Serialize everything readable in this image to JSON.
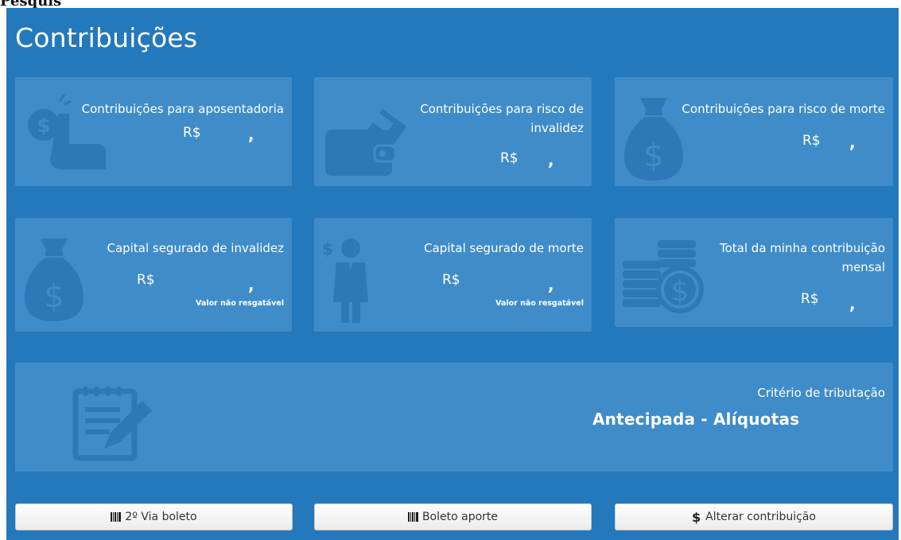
{
  "top_label": "Pesquis",
  "title": "Contribuições",
  "cards": [
    {
      "label": "Contribuições para aposentadoria",
      "currency": "R$",
      "comma": ","
    },
    {
      "label_line1": "Contribuições para risco de",
      "label_line2": "invalidez",
      "currency": "R$",
      "comma": ","
    },
    {
      "label": "Contribuições para risco de morte",
      "currency": "R$",
      "comma": ","
    },
    {
      "label": "Capital segurado de invalidez",
      "currency": "R$",
      "comma": ",",
      "note": "Valor não resgatável"
    },
    {
      "label": "Capital segurado de morte",
      "currency": "R$",
      "comma": ",",
      "note": "Valor não resgatável"
    },
    {
      "label_line1": "Total da minha contribuição",
      "label_line2": "mensal",
      "currency": "R$",
      "comma": ","
    }
  ],
  "tax": {
    "label": "Critério de tributação",
    "value": "Antecipada - Alíquotas"
  },
  "buttons": {
    "second_copy": "2º Via boleto",
    "boleto_aporte": "Boleto aporte",
    "alterar": "Alterar contribuição",
    "dollar_symbol": "$"
  },
  "colors": {
    "panel": "#2478bc",
    "card": "#3f8cc9",
    "icon": "#2e78b8"
  },
  "icons": [
    "coin-hand-icon",
    "wallet-icon",
    "money-bag-icon",
    "money-bag-icon",
    "businessman-dollar-icon",
    "coin-stack-icon",
    "notepad-pencil-icon",
    "barcode-icon",
    "dollar-icon"
  ]
}
